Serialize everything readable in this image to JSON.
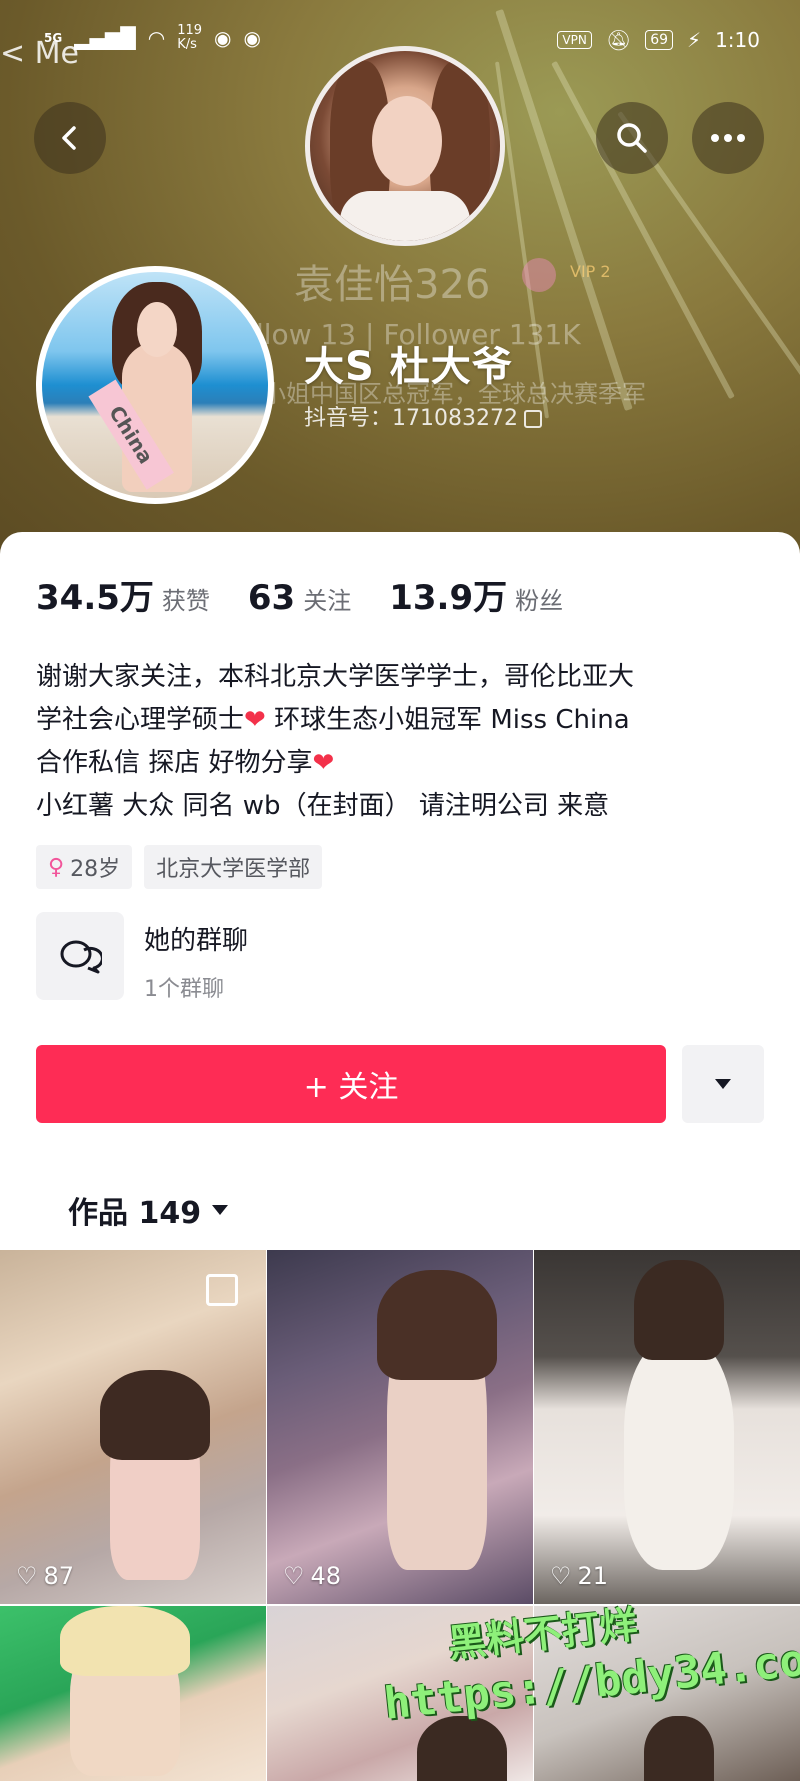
{
  "status_bar": {
    "net": "5G",
    "speed": "119\nK/s",
    "vpn": "VPN",
    "battery": "69",
    "time": "1:10",
    "overlay_text": "< Me"
  },
  "header": {
    "faded_username": "袁佳怡326",
    "faded_vip": "VIP 2",
    "faded_follow": "llow  13  |  Follower  131K",
    "faded_bio": "小姐中国区总冠军，全球总决赛季军",
    "display_name": "大S 杜大爷",
    "douyin_id_label": "抖音号：171083272",
    "avatar_sash": "China"
  },
  "stats": [
    {
      "value": "34.5万",
      "label": "获赞"
    },
    {
      "value": "63",
      "label": "关注"
    },
    {
      "value": "13.9万",
      "label": "粉丝"
    }
  ],
  "bio": {
    "line1": "谢谢大家关注，本科北京大学医学学士，哥伦比亚大",
    "line2": "学社会心理学硕士",
    "line2b": " 环球生态小姐冠军 Miss China",
    "line3": "合作私信 探店 好物分享",
    "line4": "小红薯 大众 同名 wb（在封面） 请注明公司 来意"
  },
  "tags": {
    "age": "28岁",
    "school": "北京大学医学部"
  },
  "group_chat": {
    "title": "她的群聊",
    "subtitle": "1个群聊"
  },
  "follow_button": "+ 关注",
  "works_tab": {
    "label": "作品 149"
  },
  "videos": [
    {
      "likes": "87"
    },
    {
      "likes": "48"
    },
    {
      "likes": "21"
    },
    {
      "likes": ""
    },
    {
      "likes": ""
    },
    {
      "likes": ""
    }
  ],
  "watermark": {
    "line1": "黑料不打烊",
    "line2": "https://bdy34.co"
  },
  "colors": {
    "accent": "#fe2c55",
    "female": "#f2559a",
    "heart": "#f3314a"
  }
}
